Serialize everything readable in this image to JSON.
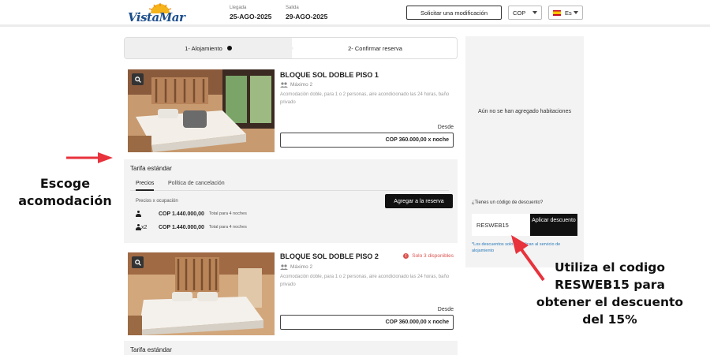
{
  "header": {
    "logo_text": "VistaMar",
    "checkin_label": "Llegada",
    "checkin_date": "25-AGO-2025",
    "checkout_label": "Salida",
    "checkout_date": "29-AGO-2025",
    "modify_button": "Solicitar una modificación",
    "currency": "COP",
    "language": "Es"
  },
  "steps": [
    {
      "label": "1- Alojamiento"
    },
    {
      "label": "2- Confirmar reserva"
    }
  ],
  "rooms": [
    {
      "title": "BLOQUE SOL DOBLE PISO 1",
      "max": "Máximo 2",
      "description": "Acomodación doble, para 1 o 2 personas, aire acondicionado las 24 horas, baño privado",
      "from_label": "Desde",
      "price": "COP 360.000,00 x noche",
      "availability": ""
    },
    {
      "title": "BLOQUE SOL DOBLE PISO 2",
      "max": "Máximo 2",
      "description": "Acomodación doble, para 1 o 2 personas, aire acondicionado las 24 horas, baño privado",
      "from_label": "Desde",
      "price": "COP 360.000,00 x noche",
      "availability": "Solo 3 disponibles"
    }
  ],
  "rates": [
    {
      "title": "Tarifa estándar",
      "tabs": [
        "Precios",
        "Política de cancelación"
      ],
      "occupancy_label": "Precios x ocupación",
      "add_button": "Agregar a la reserva",
      "rows": [
        {
          "persons": "",
          "amount": "COP 1.440.000,00",
          "nights": "Total para 4 noches"
        },
        {
          "persons": "x2",
          "amount": "COP 1.440.000,00",
          "nights": "Total para 4 noches"
        }
      ]
    },
    {
      "title": "Tarifa estándar"
    }
  ],
  "panel": {
    "empty_text": "Aún no se han agregado habitaciones",
    "discount_question": "¿Tienes un código de descuento?",
    "discount_code": "RESWEB15",
    "apply_button": "Aplicar descuento",
    "note": "*Los descuentos solo se aplican al servicio de alojamiento"
  },
  "annotations": {
    "left": "Escoge acomodación",
    "right": "Utiliza el codigo RESWEB15 para obtener el descuento del 15%"
  },
  "colors": {
    "accent": "#111111",
    "arrow": "#e8323c",
    "link": "#2a7ab8",
    "alert": "#d9534f",
    "logo": "#1c4e8c"
  }
}
